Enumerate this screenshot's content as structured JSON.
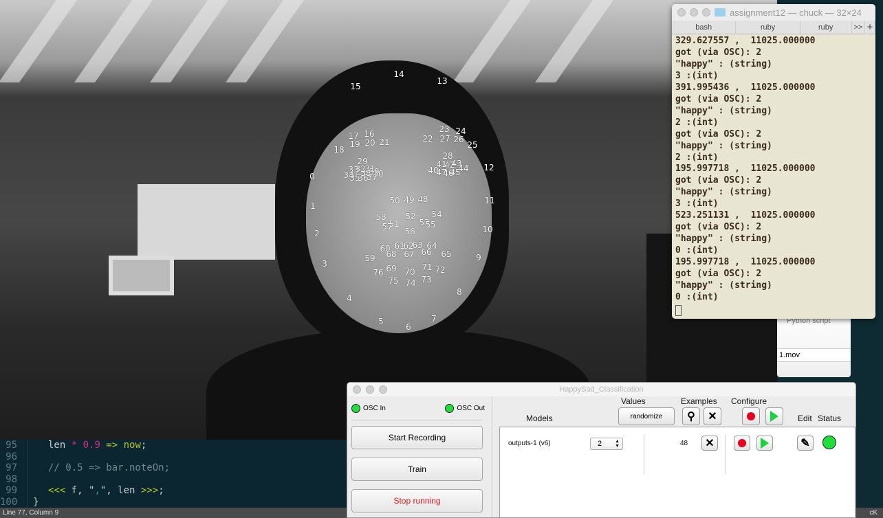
{
  "camera": {
    "landmarks": [
      "0",
      "1",
      "2",
      "3",
      "4",
      "5",
      "6",
      "7",
      "8",
      "9",
      "10",
      "11",
      "12",
      "13",
      "14",
      "15",
      "16",
      "17",
      "18",
      "19",
      "20",
      "21",
      "22",
      "23",
      "24",
      "25",
      "26",
      "27",
      "28",
      "29",
      "30",
      "31",
      "32",
      "33",
      "34",
      "35",
      "36",
      "37",
      "38",
      "39",
      "40",
      "41",
      "42",
      "43",
      "44",
      "45",
      "46",
      "47",
      "48",
      "49",
      "50",
      "51",
      "52",
      "53",
      "54",
      "55",
      "56",
      "57",
      "58",
      "59",
      "60",
      "61",
      "62",
      "63",
      "64",
      "65",
      "66",
      "67",
      "68",
      "69",
      "70",
      "71",
      "72",
      "73",
      "74",
      "75",
      "76"
    ]
  },
  "terminal": {
    "title": "assignment12 — chuck — 32×24",
    "tabs": [
      "bash",
      "ruby",
      "ruby"
    ],
    "more": ">>",
    "add": "+",
    "lines": [
      "329.627557 ,  11025.000000",
      "got (via OSC): 2",
      "\"happy\" : (string)",
      "3 :(int)",
      "391.995436 ,  11025.000000",
      "got (via OSC): 2",
      "\"happy\" : (string)",
      "2 :(int)",
      "got (via OSC): 2",
      "\"happy\" : (string)",
      "2 :(int)",
      "195.997718 ,  11025.000000",
      "got (via OSC): 2",
      "\"happy\" : (string)",
      "3 :(int)",
      "523.251131 ,  11025.000000",
      "got (via OSC): 2",
      "\"happy\" : (string)",
      "0 :(int)",
      "195.997718 ,  11025.000000",
      "got (via OSC): 2",
      "\"happy\" : (string)",
      "0 :(int)"
    ]
  },
  "finder": {
    "items": [
      "Python script",
      "1.mov"
    ]
  },
  "editor": {
    "lines": [
      {
        "n": "95"
      },
      {
        "n": "96"
      },
      {
        "n": "97",
        "comment": "// 0.5 => bar.noteOn;"
      },
      {
        "n": "98"
      },
      {
        "n": "99"
      },
      {
        "n": "100",
        "text": "}"
      }
    ],
    "l95": {
      "a": "len ",
      "op": "*",
      "num": " 0.9",
      "arrow": " =>",
      "kw": " now",
      ";": ";"
    },
    "l99": {
      "a": "<<<",
      "b": " f, \"",
      "c": ",",
      "d": "\", len ",
      "e": ">>>",
      ";": ";"
    }
  },
  "status": {
    "position": "Line 77, Column 9",
    "right": "cK"
  },
  "app": {
    "title": "HappySad_Classification",
    "osc_in": "OSC In",
    "osc_out": "OSC Out",
    "buttons": {
      "record": "Start Recording",
      "train": "Train",
      "stop": "Stop running"
    },
    "headers": {
      "values": "Values",
      "examples": "Examples",
      "configure": "Configure",
      "models": "Models",
      "edit": "Edit",
      "status": "Status"
    },
    "randomize": "randomize",
    "model": {
      "name": "outputs-1 (v6)",
      "value": "2",
      "examples": "48"
    },
    "colors": {
      "led": "#1fe03a",
      "record": "#e8001c",
      "play": "#16d43c",
      "stop_text": "#e8141c"
    }
  }
}
